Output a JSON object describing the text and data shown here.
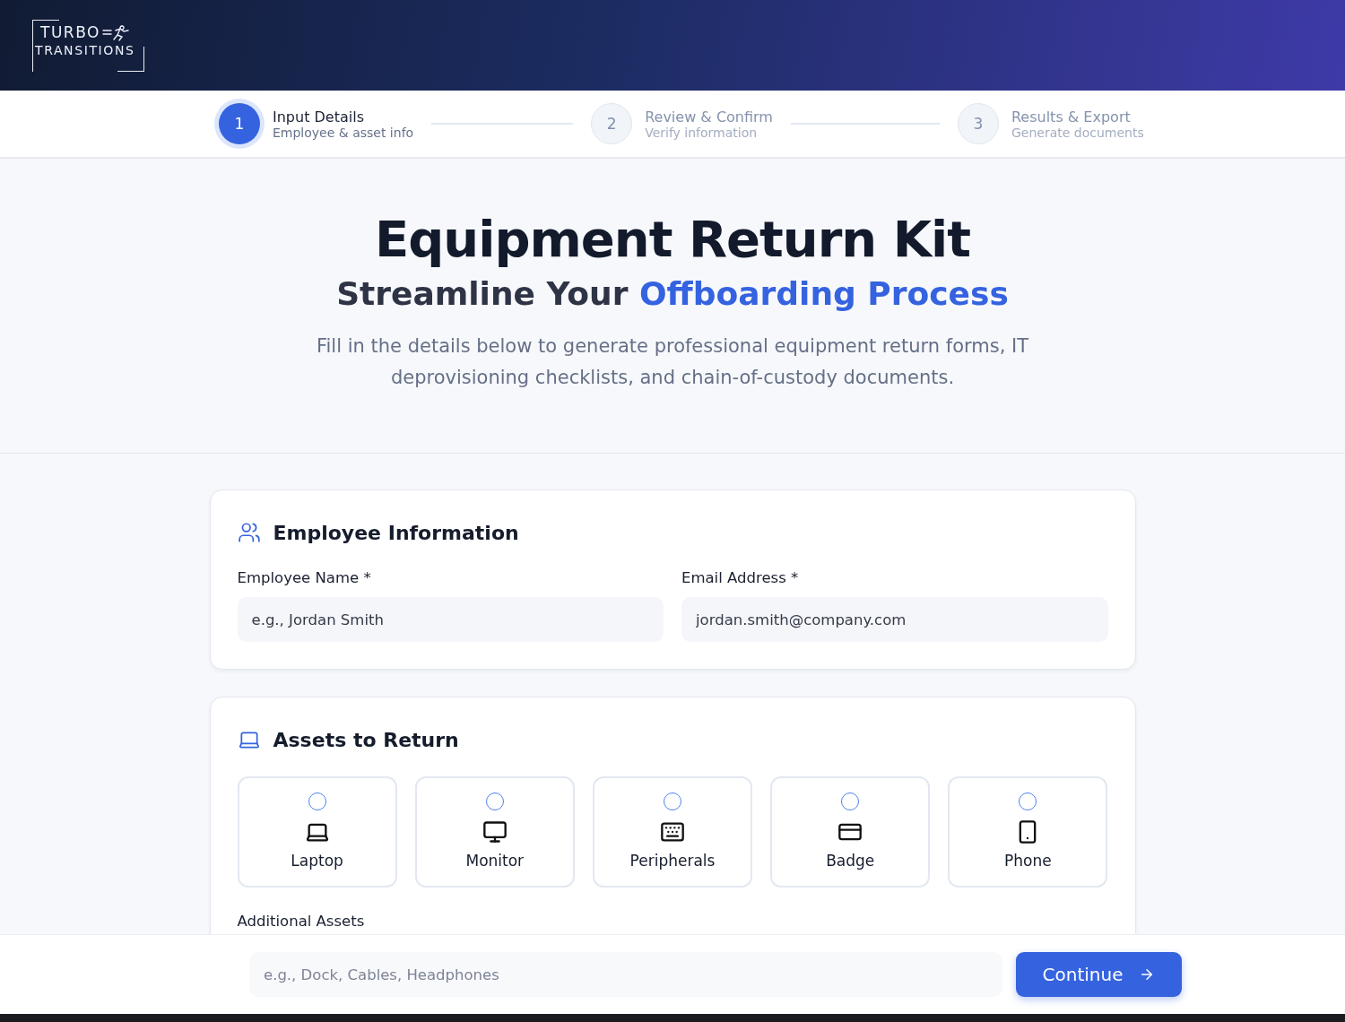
{
  "logo": {
    "line_1": "TURBO",
    "line_2": "TRANSITIONS"
  },
  "steps": [
    {
      "number": "1",
      "title": "Input Details",
      "subtitle": "Employee & asset info",
      "selected": true
    },
    {
      "number": "2",
      "title": "Review & Confirm",
      "subtitle": "Verify information",
      "selected": false
    },
    {
      "number": "3",
      "title": "Results & Export",
      "subtitle": "Generate documents",
      "selected": false
    }
  ],
  "hero": {
    "title": "Equipment Return Kit",
    "subtitle": "Streamline Your",
    "subtitle_highlight": "Offboarding Process",
    "description": "Fill in the details below to generate professional equipment return forms, IT deprovisioning checklists, and chain-of-custody documents."
  },
  "employee_card": {
    "title": "Employee Information",
    "fields": [
      {
        "label": "Employee Name *",
        "placeholder": "e.g., Jordan Smith"
      },
      {
        "label": "Email Address *",
        "placeholder": "jordan.smith@company.com"
      }
    ]
  },
  "assets_card": {
    "title": "Assets to Return",
    "assets": [
      {
        "label": "Laptop",
        "checked": false
      },
      {
        "label": "Monitor",
        "checked": false
      },
      {
        "label": "Peripherals",
        "checked": false
      },
      {
        "label": "Badge",
        "checked": false
      },
      {
        "label": "Phone",
        "checked": false
      }
    ],
    "additional": {
      "label": "Additional Assets",
      "placeholder": "e.g., Dock, Cables, Headphones"
    }
  },
  "footer": {
    "button": "Continue"
  }
}
